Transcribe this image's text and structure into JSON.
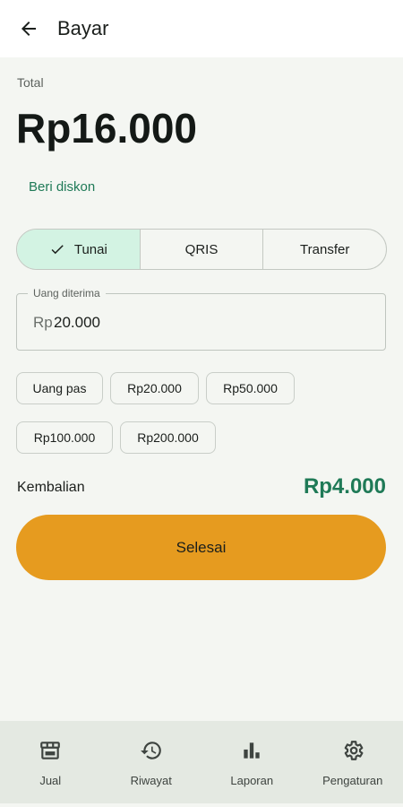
{
  "header": {
    "title": "Bayar",
    "back_icon": "arrow-back-icon"
  },
  "summary": {
    "total_label": "Total",
    "total_value": "Rp16.000",
    "discount_label": "Beri diskon"
  },
  "payment_methods": {
    "selected": "Tunai",
    "options": [
      {
        "label": "Tunai",
        "icon": "check-icon"
      },
      {
        "label": "QRIS"
      },
      {
        "label": "Transfer"
      }
    ]
  },
  "amount_field": {
    "label": "Uang diterima",
    "prefix": "Rp",
    "value": "20.000"
  },
  "quick_amounts": [
    "Uang pas",
    "Rp20.000",
    "Rp50.000",
    "Rp100.000",
    "Rp200.000"
  ],
  "change": {
    "label": "Kembalian",
    "value": "Rp4.000"
  },
  "primary_action": {
    "label": "Selesai"
  },
  "bottom_nav": [
    {
      "label": "Jual",
      "icon": "store-icon"
    },
    {
      "label": "Riwayat",
      "icon": "history-icon"
    },
    {
      "label": "Laporan",
      "icon": "bar-chart-icon"
    },
    {
      "label": "Pengaturan",
      "icon": "gear-icon"
    }
  ],
  "colors": {
    "accent_green": "#1f7a57",
    "selected_chip": "#d3f3e3",
    "primary_button": "#e69b1f",
    "background": "#f4f6f2"
  }
}
